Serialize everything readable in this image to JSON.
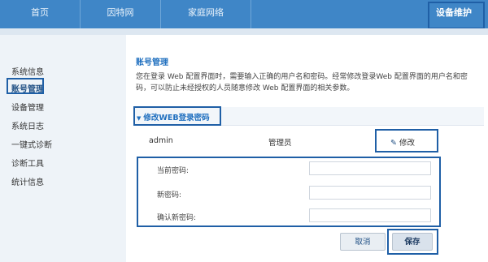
{
  "nav": {
    "tabs": [
      {
        "label": "首页"
      },
      {
        "label": "因特网"
      },
      {
        "label": "家庭网络"
      }
    ],
    "active_tab": "设备维护"
  },
  "sidebar": {
    "items": [
      {
        "label": "系统信息"
      },
      {
        "label": "账号管理"
      },
      {
        "label": "设备管理"
      },
      {
        "label": "系统日志"
      },
      {
        "label": "一键式诊断"
      },
      {
        "label": "诊断工具"
      },
      {
        "label": "统计信息"
      }
    ]
  },
  "main": {
    "title": "账号管理",
    "description": "您在登录 Web 配置界面时，需要输入正确的用户名和密码。经常修改登录Web 配置界面的用户名和密码，可以防止未经授权的人员随意修改 Web 配置界面的相关参数。",
    "section_label": "修改WEB登录密码",
    "account": {
      "username": "admin",
      "role": "管理员",
      "edit_label": "修改"
    },
    "fields": [
      {
        "label": "当前密码:",
        "value": ""
      },
      {
        "label": "新密码:",
        "value": ""
      },
      {
        "label": "确认新密码:",
        "value": ""
      }
    ],
    "cancel_label": "取消",
    "save_label": "保存"
  },
  "colors": {
    "nav_bg": "#3f86c7",
    "accent": "#1f6fbf",
    "highlight_border": "#1f5fa6",
    "sidebar_bg": "#eef3f8"
  }
}
